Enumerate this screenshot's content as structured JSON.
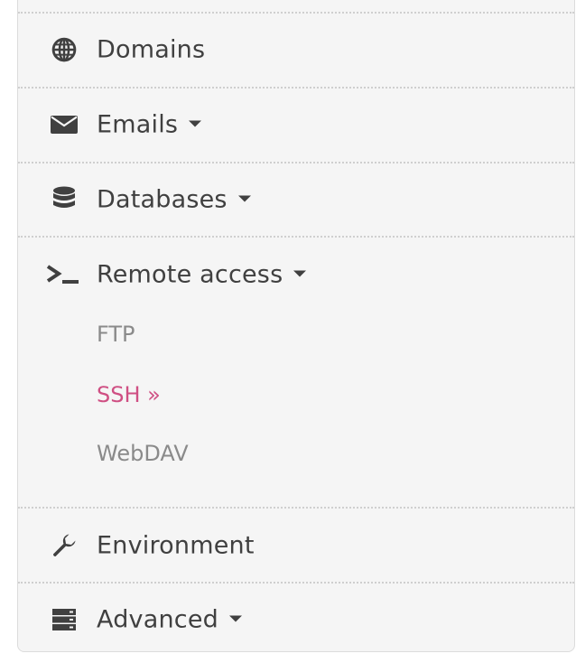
{
  "nav": {
    "items": [
      {
        "label": "Domains",
        "icon": "globe-icon"
      },
      {
        "label": "Emails",
        "icon": "envelope-icon"
      },
      {
        "label": "Databases",
        "icon": "database-icon"
      },
      {
        "label": "Remote access",
        "icon": "terminal-icon"
      },
      {
        "label": "Environment",
        "icon": "wrench-icon"
      },
      {
        "label": "Advanced",
        "icon": "server-icon"
      }
    ],
    "remote_access_subitems": [
      {
        "label": "FTP"
      },
      {
        "label": "SSH »",
        "active": true
      },
      {
        "label": "WebDAV"
      }
    ]
  },
  "colors": {
    "text": "#404040",
    "muted": "#8a8a8a",
    "active": "#cf4f83",
    "panel_bg": "#f5f5f5",
    "separator": "#cfcfcf"
  }
}
